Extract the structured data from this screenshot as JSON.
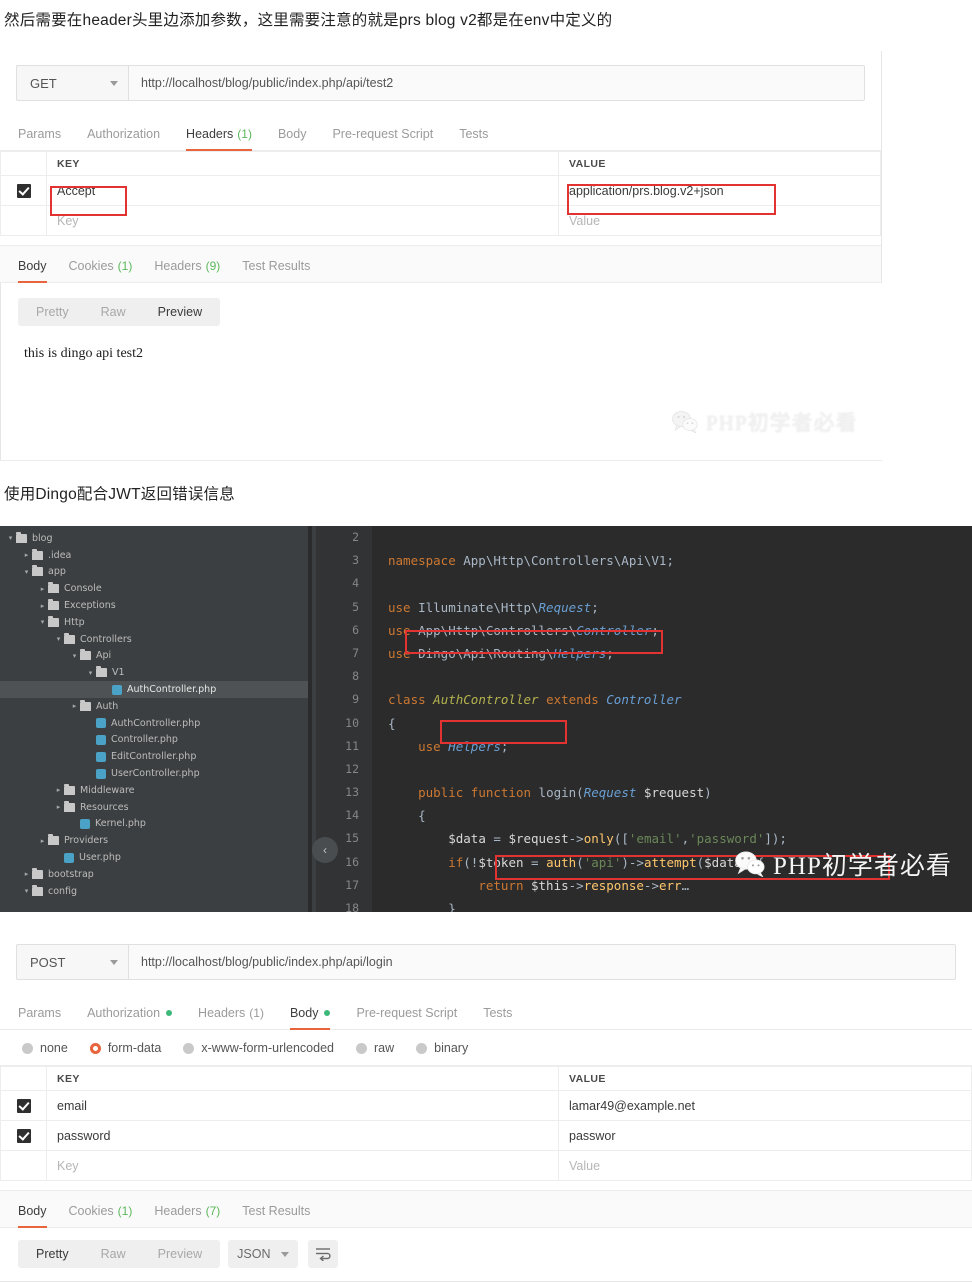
{
  "article": {
    "paragraph1": "然后需要在header头里边添加参数，这里需要注意的就是prs  blog  v2都是在env中定义的",
    "heading2": "使用Dingo配合JWT返回错误信息"
  },
  "watermark": {
    "text": "PHP初学者必看",
    "icon": "wechat-icon"
  },
  "postman_top": {
    "method": "GET",
    "url": "http://localhost/blog/public/index.php/api/test2",
    "request_tabs": [
      {
        "label": "Params",
        "active": false,
        "count": "",
        "dot": false
      },
      {
        "label": "Authorization",
        "active": false,
        "count": "",
        "dot": false
      },
      {
        "label": "Headers",
        "active": true,
        "count": "(1)",
        "dot": false
      },
      {
        "label": "Body",
        "active": false,
        "count": "",
        "dot": false
      },
      {
        "label": "Pre-request Script",
        "active": false,
        "count": "",
        "dot": false
      },
      {
        "label": "Tests",
        "active": false,
        "count": "",
        "dot": false
      }
    ],
    "table": {
      "headers": [
        "KEY",
        "VALUE"
      ],
      "rows": [
        {
          "checked": true,
          "key": "Accept",
          "value": "application/prs.blog.v2+json",
          "placeholder": false
        },
        {
          "checked": false,
          "key": "Key",
          "value": "Value",
          "placeholder": true
        }
      ]
    },
    "response_tabs": [
      {
        "label": "Body",
        "active": true,
        "count": ""
      },
      {
        "label": "Cookies",
        "active": false,
        "count": "(1)"
      },
      {
        "label": "Headers",
        "active": false,
        "count": "(9)"
      },
      {
        "label": "Test Results",
        "active": false,
        "count": ""
      }
    ],
    "view_modes": [
      {
        "label": "Pretty",
        "active": false
      },
      {
        "label": "Raw",
        "active": false
      },
      {
        "label": "Preview",
        "active": true
      }
    ],
    "response_body": "this is dingo api test2"
  },
  "ide": {
    "tree": [
      {
        "label": "blog",
        "indent": 0,
        "arrow": "down",
        "type": "folder",
        "selected": false
      },
      {
        "label": ".idea",
        "indent": 1,
        "arrow": "right",
        "type": "folder",
        "selected": false
      },
      {
        "label": "app",
        "indent": 1,
        "arrow": "down",
        "type": "folder",
        "selected": false
      },
      {
        "label": "Console",
        "indent": 2,
        "arrow": "right",
        "type": "folder",
        "selected": false
      },
      {
        "label": "Exceptions",
        "indent": 2,
        "arrow": "right",
        "type": "folder",
        "selected": false
      },
      {
        "label": "Http",
        "indent": 2,
        "arrow": "down",
        "type": "folder",
        "selected": false
      },
      {
        "label": "Controllers",
        "indent": 3,
        "arrow": "down",
        "type": "folder",
        "selected": false
      },
      {
        "label": "Api",
        "indent": 4,
        "arrow": "down",
        "type": "folder",
        "selected": false
      },
      {
        "label": "V1",
        "indent": 5,
        "arrow": "down",
        "type": "folder",
        "selected": false
      },
      {
        "label": "AuthController.php",
        "indent": 6,
        "arrow": "none",
        "type": "php",
        "selected": true
      },
      {
        "label": "Auth",
        "indent": 4,
        "arrow": "right",
        "type": "folder",
        "selected": false
      },
      {
        "label": "AuthController.php",
        "indent": 5,
        "arrow": "none",
        "type": "php",
        "selected": false
      },
      {
        "label": "Controller.php",
        "indent": 5,
        "arrow": "none",
        "type": "php",
        "selected": false
      },
      {
        "label": "EditController.php",
        "indent": 5,
        "arrow": "none",
        "type": "php",
        "selected": false
      },
      {
        "label": "UserController.php",
        "indent": 5,
        "arrow": "none",
        "type": "php",
        "selected": false
      },
      {
        "label": "Middleware",
        "indent": 3,
        "arrow": "right",
        "type": "folder",
        "selected": false
      },
      {
        "label": "Resources",
        "indent": 3,
        "arrow": "right",
        "type": "folder",
        "selected": false
      },
      {
        "label": "Kernel.php",
        "indent": 4,
        "arrow": "none",
        "type": "php",
        "selected": false
      },
      {
        "label": "Providers",
        "indent": 2,
        "arrow": "right",
        "type": "folder",
        "selected": false
      },
      {
        "label": "User.php",
        "indent": 3,
        "arrow": "none",
        "type": "php",
        "selected": false
      },
      {
        "label": "bootstrap",
        "indent": 1,
        "arrow": "right",
        "type": "folder",
        "selected": false
      },
      {
        "label": "config",
        "indent": 1,
        "arrow": "down",
        "type": "folder",
        "selected": false
      }
    ],
    "code_lines": [
      {
        "num": "2",
        "text": ""
      },
      {
        "num": "3",
        "text": "namespace App\\Http\\Controllers\\Api\\V1;"
      },
      {
        "num": "4",
        "text": ""
      },
      {
        "num": "5",
        "text": "use Illuminate\\Http\\Request;"
      },
      {
        "num": "6",
        "text": "use App\\Http\\Controllers\\Controller;"
      },
      {
        "num": "7",
        "text": "use Dingo\\Api\\Routing\\Helpers;"
      },
      {
        "num": "8",
        "text": ""
      },
      {
        "num": "9",
        "text": "class AuthController extends Controller"
      },
      {
        "num": "10",
        "text": "{"
      },
      {
        "num": "11",
        "text": "    use Helpers;"
      },
      {
        "num": "12",
        "text": ""
      },
      {
        "num": "13",
        "text": "    public function login(Request $request)"
      },
      {
        "num": "14",
        "text": "    {"
      },
      {
        "num": "15",
        "text": "        $data = $request->only(['email','password']);"
      },
      {
        "num": "16",
        "text": "        if(!$token = auth('api')->attempt($data)){"
      },
      {
        "num": "17",
        "text": "            return $this->response->err…"
      },
      {
        "num": "18",
        "text": "        }"
      }
    ],
    "collapse_icon": "chevron-left-icon"
  },
  "postman_bottom": {
    "method": "POST",
    "url": "http://localhost/blog/public/index.php/api/login",
    "request_tabs": [
      {
        "label": "Params",
        "active": false,
        "count": "",
        "dot": false
      },
      {
        "label": "Authorization",
        "active": false,
        "count": "",
        "dot": true
      },
      {
        "label": "Headers",
        "active": false,
        "count": "(1)",
        "dot": false
      },
      {
        "label": "Body",
        "active": true,
        "count": "",
        "dot": true
      },
      {
        "label": "Pre-request Script",
        "active": false,
        "count": "",
        "dot": false
      },
      {
        "label": "Tests",
        "active": false,
        "count": "",
        "dot": false
      }
    ],
    "body_types": [
      {
        "label": "none",
        "selected": false
      },
      {
        "label": "form-data",
        "selected": true
      },
      {
        "label": "x-www-form-urlencoded",
        "selected": false
      },
      {
        "label": "raw",
        "selected": false
      },
      {
        "label": "binary",
        "selected": false
      }
    ],
    "table": {
      "headers": [
        "KEY",
        "VALUE"
      ],
      "rows": [
        {
          "checked": true,
          "key": "email",
          "value": "lamar49@example.net",
          "placeholder": false
        },
        {
          "checked": true,
          "key": "password",
          "value": "passwor",
          "placeholder": false
        },
        {
          "checked": false,
          "key": "Key",
          "value": "Value",
          "placeholder": true
        }
      ]
    },
    "response_tabs": [
      {
        "label": "Body",
        "active": true,
        "count": ""
      },
      {
        "label": "Cookies",
        "active": false,
        "count": "(1)"
      },
      {
        "label": "Headers",
        "active": false,
        "count": "(7)"
      },
      {
        "label": "Test Results",
        "active": false,
        "count": ""
      }
    ],
    "view_modes": [
      {
        "label": "Pretty",
        "active": true
      },
      {
        "label": "Raw",
        "active": false
      },
      {
        "label": "Preview",
        "active": false
      }
    ],
    "format": "JSON",
    "wrap_icon": "wrap-lines-icon"
  },
  "colors": {
    "accent": "#e8643c",
    "green": "#5bb85b",
    "annotation_red": "#e23232",
    "ide_bg": "#2b2b2b",
    "ide_panel": "#3c3f41"
  }
}
